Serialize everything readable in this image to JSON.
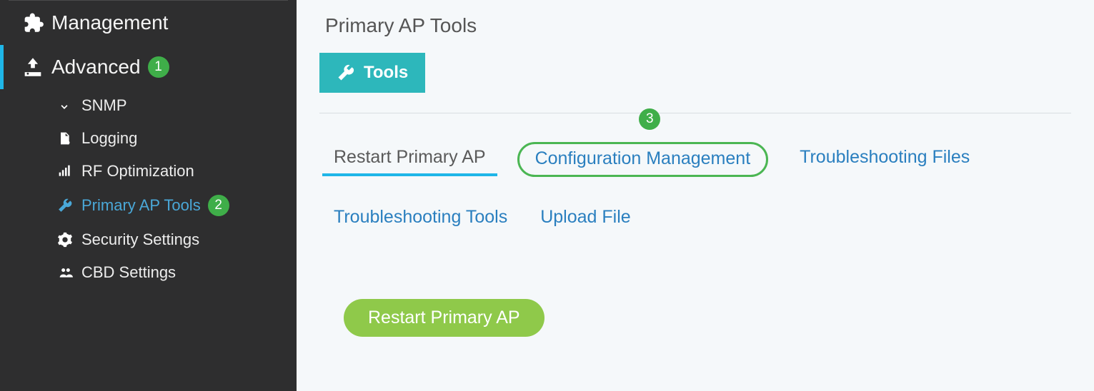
{
  "sidebar": {
    "management": {
      "label": "Management"
    },
    "advanced": {
      "label": "Advanced",
      "badge": "1"
    },
    "items": [
      {
        "label": "SNMP"
      },
      {
        "label": "Logging"
      },
      {
        "label": "RF Optimization"
      },
      {
        "label": "Primary AP Tools",
        "badge": "2"
      },
      {
        "label": "Security Settings"
      },
      {
        "label": "CBD Settings"
      }
    ]
  },
  "main": {
    "title": "Primary AP Tools",
    "tools_button": "Tools",
    "tabs": [
      {
        "label": "Restart Primary AP"
      },
      {
        "label": "Configuration Management",
        "badge": "3"
      },
      {
        "label": "Troubleshooting Files"
      },
      {
        "label": "Troubleshooting Tools"
      },
      {
        "label": "Upload File"
      }
    ],
    "restart_button": "Restart Primary AP"
  }
}
